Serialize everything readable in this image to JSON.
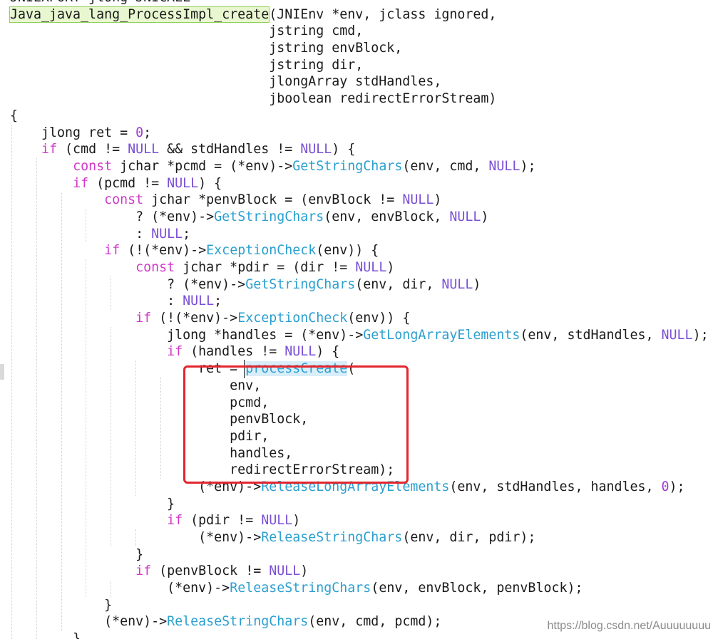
{
  "editor": {
    "lines": [
      {
        "indent": 0,
        "tokens": [
          {
            "t": "JNIEXPORT jlong JNICALL"
          }
        ]
      },
      {
        "indent": 0,
        "tokens": [
          {
            "t": "Java_java_lang_ProcessImpl_create",
            "c": "hl"
          },
          {
            "t": "(JNIEnv *env, jclass ignored,"
          }
        ]
      },
      {
        "indent": 0,
        "tokens": [
          {
            "t": "                                 jstring cmd,"
          }
        ]
      },
      {
        "indent": 0,
        "tokens": [
          {
            "t": "                                 jstring envBlock,"
          }
        ]
      },
      {
        "indent": 0,
        "tokens": [
          {
            "t": "                                 jstring dir,"
          }
        ]
      },
      {
        "indent": 0,
        "tokens": [
          {
            "t": "                                 jlongArray stdHandles,"
          }
        ]
      },
      {
        "indent": 0,
        "tokens": [
          {
            "t": "                                 jboolean redirectErrorStream)"
          }
        ]
      },
      {
        "indent": 0,
        "tokens": [
          {
            "t": "{"
          }
        ]
      },
      {
        "indent": 0,
        "tokens": [
          {
            "t": "    jlong ret = "
          },
          {
            "t": "0",
            "c": "num"
          },
          {
            "t": ";"
          }
        ]
      },
      {
        "indent": 0,
        "tokens": [
          {
            "t": "    "
          },
          {
            "t": "if",
            "c": "kw"
          },
          {
            "t": " (cmd != "
          },
          {
            "t": "NULL",
            "c": "const"
          },
          {
            "t": " && stdHandles != "
          },
          {
            "t": "NULL",
            "c": "const"
          },
          {
            "t": ") {"
          }
        ]
      },
      {
        "indent": 0,
        "tokens": [
          {
            "t": "        "
          },
          {
            "t": "const",
            "c": "kw"
          },
          {
            "t": " jchar *pcmd = (*env)->"
          },
          {
            "t": "GetStringChars",
            "c": "fn"
          },
          {
            "t": "(env, cmd, "
          },
          {
            "t": "NULL",
            "c": "const"
          },
          {
            "t": ");"
          }
        ]
      },
      {
        "indent": 0,
        "tokens": [
          {
            "t": "        "
          },
          {
            "t": "if",
            "c": "kw"
          },
          {
            "t": " (pcmd != "
          },
          {
            "t": "NULL",
            "c": "const"
          },
          {
            "t": ") {"
          }
        ]
      },
      {
        "indent": 0,
        "tokens": [
          {
            "t": "            "
          },
          {
            "t": "const",
            "c": "kw"
          },
          {
            "t": " jchar *penvBlock = (envBlock != "
          },
          {
            "t": "NULL",
            "c": "const"
          },
          {
            "t": ")"
          }
        ]
      },
      {
        "indent": 0,
        "tokens": [
          {
            "t": "                ? (*env)->"
          },
          {
            "t": "GetStringChars",
            "c": "fn"
          },
          {
            "t": "(env, envBlock, "
          },
          {
            "t": "NULL",
            "c": "const"
          },
          {
            "t": ")"
          }
        ]
      },
      {
        "indent": 0,
        "tokens": [
          {
            "t": "                : "
          },
          {
            "t": "NULL",
            "c": "const"
          },
          {
            "t": ";"
          }
        ]
      },
      {
        "indent": 0,
        "tokens": [
          {
            "t": "            "
          },
          {
            "t": "if",
            "c": "kw"
          },
          {
            "t": " (!(*env)->"
          },
          {
            "t": "ExceptionCheck",
            "c": "fn"
          },
          {
            "t": "(env)) {"
          }
        ]
      },
      {
        "indent": 0,
        "tokens": [
          {
            "t": "                "
          },
          {
            "t": "const",
            "c": "kw"
          },
          {
            "t": " jchar *pdir = (dir != "
          },
          {
            "t": "NULL",
            "c": "const"
          },
          {
            "t": ")"
          }
        ]
      },
      {
        "indent": 0,
        "tokens": [
          {
            "t": "                    ? (*env)->"
          },
          {
            "t": "GetStringChars",
            "c": "fn"
          },
          {
            "t": "(env, dir, "
          },
          {
            "t": "NULL",
            "c": "const"
          },
          {
            "t": ")"
          }
        ]
      },
      {
        "indent": 0,
        "tokens": [
          {
            "t": "                    : "
          },
          {
            "t": "NULL",
            "c": "const"
          },
          {
            "t": ";"
          }
        ]
      },
      {
        "indent": 0,
        "tokens": [
          {
            "t": "                "
          },
          {
            "t": "if",
            "c": "kw"
          },
          {
            "t": " (!(*env)->"
          },
          {
            "t": "ExceptionCheck",
            "c": "fn"
          },
          {
            "t": "(env)) {"
          }
        ]
      },
      {
        "indent": 0,
        "tokens": [
          {
            "t": "                    jlong *handles = (*env)->"
          },
          {
            "t": "GetLongArrayElements",
            "c": "fn"
          },
          {
            "t": "(env, stdHandles, "
          },
          {
            "t": "NULL",
            "c": "const"
          },
          {
            "t": ");"
          }
        ]
      },
      {
        "indent": 0,
        "tokens": [
          {
            "t": "                    "
          },
          {
            "t": "if",
            "c": "kw"
          },
          {
            "t": " (handles != "
          },
          {
            "t": "NULL",
            "c": "const"
          },
          {
            "t": ") {"
          }
        ]
      },
      {
        "indent": 0,
        "tokens": [
          {
            "t": "                        ret = "
          },
          {
            "t": "processCreate",
            "c": "fnsel"
          },
          {
            "t": "("
          }
        ]
      },
      {
        "indent": 0,
        "tokens": [
          {
            "t": "                            env,"
          }
        ]
      },
      {
        "indent": 0,
        "tokens": [
          {
            "t": "                            pcmd,"
          }
        ]
      },
      {
        "indent": 0,
        "tokens": [
          {
            "t": "                            penvBlock,"
          }
        ]
      },
      {
        "indent": 0,
        "tokens": [
          {
            "t": "                            pdir,"
          }
        ]
      },
      {
        "indent": 0,
        "tokens": [
          {
            "t": "                            handles,"
          }
        ]
      },
      {
        "indent": 0,
        "tokens": [
          {
            "t": "                            redirectErrorStream);"
          }
        ]
      },
      {
        "indent": 0,
        "tokens": [
          {
            "t": "                        (*env)->"
          },
          {
            "t": "ReleaseLongArrayElements",
            "c": "fn"
          },
          {
            "t": "(env, stdHandles, handles, "
          },
          {
            "t": "0",
            "c": "num"
          },
          {
            "t": ");"
          }
        ]
      },
      {
        "indent": 0,
        "tokens": [
          {
            "t": "                    }"
          }
        ]
      },
      {
        "indent": 0,
        "tokens": [
          {
            "t": "                    "
          },
          {
            "t": "if",
            "c": "kw"
          },
          {
            "t": " (pdir != "
          },
          {
            "t": "NULL",
            "c": "const"
          },
          {
            "t": ")"
          }
        ]
      },
      {
        "indent": 0,
        "tokens": [
          {
            "t": "                        (*env)->"
          },
          {
            "t": "ReleaseStringChars",
            "c": "fn"
          },
          {
            "t": "(env, dir, pdir);"
          }
        ]
      },
      {
        "indent": 0,
        "tokens": [
          {
            "t": "                }"
          }
        ]
      },
      {
        "indent": 0,
        "tokens": [
          {
            "t": "                "
          },
          {
            "t": "if",
            "c": "kw"
          },
          {
            "t": " (penvBlock != "
          },
          {
            "t": "NULL",
            "c": "const"
          },
          {
            "t": ")"
          }
        ]
      },
      {
        "indent": 0,
        "tokens": [
          {
            "t": "                    (*env)->"
          },
          {
            "t": "ReleaseStringChars",
            "c": "fn"
          },
          {
            "t": "(env, envBlock, penvBlock);"
          }
        ]
      },
      {
        "indent": 0,
        "tokens": [
          {
            "t": "            }"
          }
        ]
      },
      {
        "indent": 0,
        "tokens": [
          {
            "t": "            (*env)->"
          },
          {
            "t": "ReleaseStringChars",
            "c": "fn"
          },
          {
            "t": "(env, cmd, pcmd);"
          }
        ]
      },
      {
        "indent": 0,
        "tokens": [
          {
            "t": "        }"
          }
        ]
      }
    ]
  },
  "colors": {
    "keyword": "#d138c8",
    "constant": "#7a4fd6",
    "function": "#2a9fd0",
    "number": "#a13ad6",
    "highlight_box": "#e3262e"
  },
  "watermark": {
    "text": "https://blog.csdn.net/Auuuuuuuu"
  }
}
